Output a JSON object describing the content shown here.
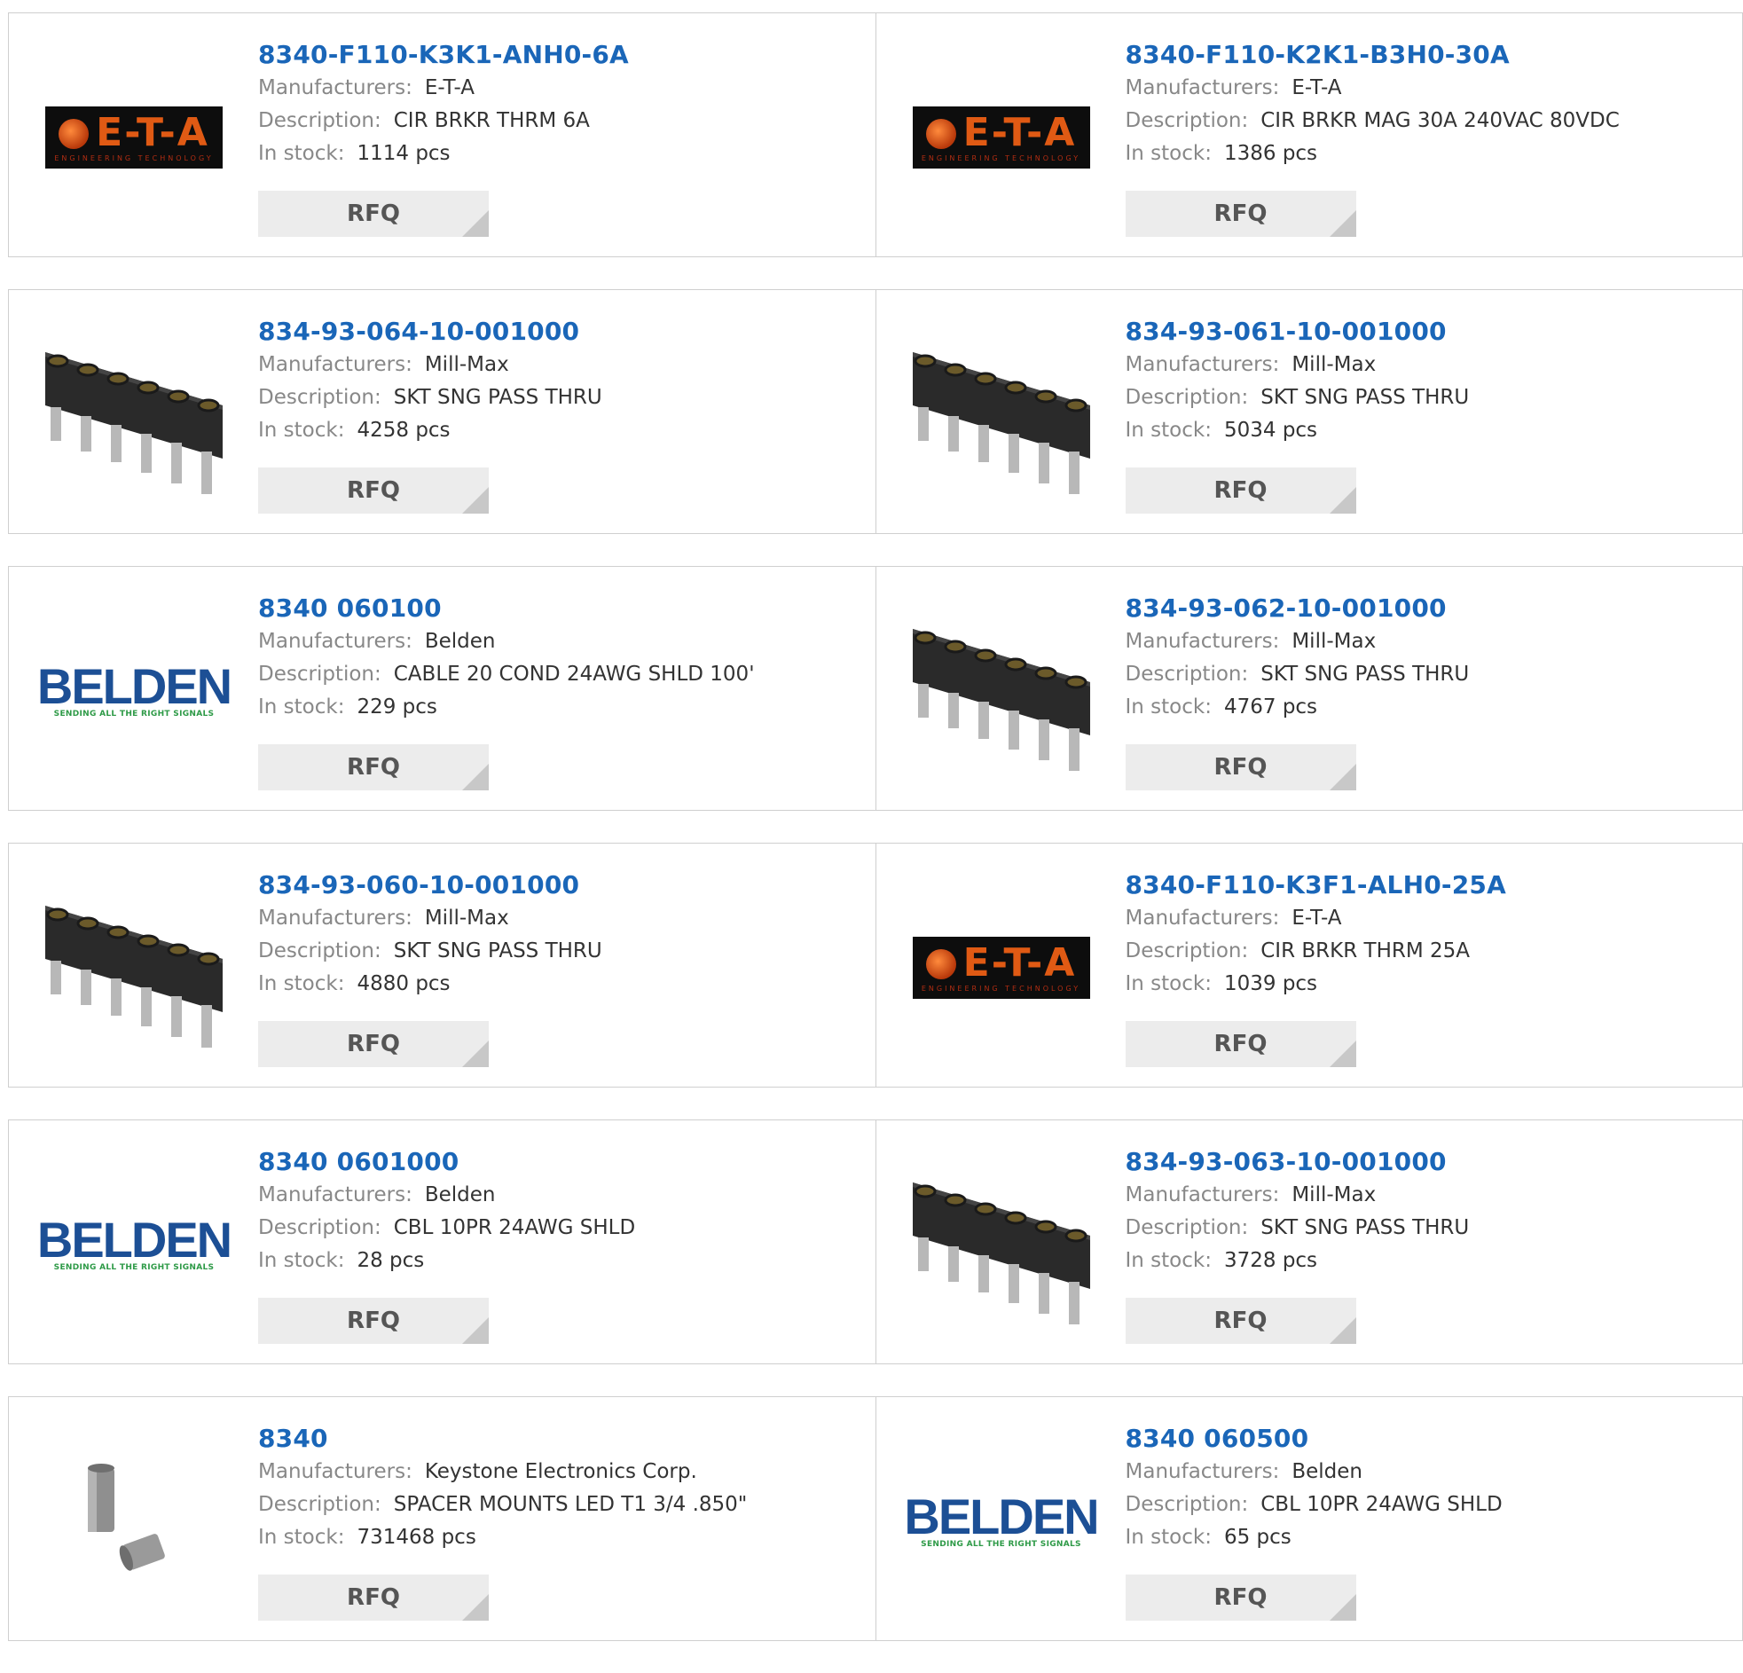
{
  "labels": {
    "manufacturers": "Manufacturers:",
    "description": "Description:",
    "in_stock": "In stock:",
    "rfq": "RFQ"
  },
  "logos": {
    "eta": {
      "main": "E-T-A",
      "sub": "ENGINEERING TECHNOLOGY"
    },
    "belden": {
      "main": "BELDEN",
      "sub": "SENDING ALL THE RIGHT SIGNALS"
    }
  },
  "colors": {
    "part_link": "#1a66b8",
    "label_gray": "#888888",
    "value_dark": "#333333",
    "rfq_bg": "#ececec",
    "border": "#cfcfcf"
  },
  "products": [
    {
      "part": "8340-F110-K3K1-ANH0-6A",
      "manufacturer": "E-T-A",
      "description": "CIR BRKR THRM 6A",
      "stock": "1114 pcs",
      "image": "eta-logo"
    },
    {
      "part": "8340-F110-K2K1-B3H0-30A",
      "manufacturer": "E-T-A",
      "description": "CIR BRKR MAG 30A 240VAC 80VDC",
      "stock": "1386 pcs",
      "image": "eta-logo"
    },
    {
      "part": "834-93-064-10-001000",
      "manufacturer": "Mill-Max",
      "description": "SKT SNG PASS THRU",
      "stock": "4258 pcs",
      "image": "socket-strip"
    },
    {
      "part": "834-93-061-10-001000",
      "manufacturer": "Mill-Max",
      "description": "SKT SNG PASS THRU",
      "stock": "5034 pcs",
      "image": "socket-strip"
    },
    {
      "part": "8340 060100",
      "manufacturer": "Belden",
      "description": "CABLE 20 COND 24AWG SHLD 100'",
      "stock": "229 pcs",
      "image": "belden-logo"
    },
    {
      "part": "834-93-062-10-001000",
      "manufacturer": "Mill-Max",
      "description": "SKT SNG PASS THRU",
      "stock": "4767 pcs",
      "image": "socket-strip"
    },
    {
      "part": "834-93-060-10-001000",
      "manufacturer": "Mill-Max",
      "description": "SKT SNG PASS THRU",
      "stock": "4880 pcs",
      "image": "socket-strip"
    },
    {
      "part": "8340-F110-K3F1-ALH0-25A",
      "manufacturer": "E-T-A",
      "description": "CIR BRKR THRM 25A",
      "stock": "1039 pcs",
      "image": "eta-logo"
    },
    {
      "part": "8340 0601000",
      "manufacturer": "Belden",
      "description": "CBL 10PR 24AWG SHLD",
      "stock": "28 pcs",
      "image": "belden-logo"
    },
    {
      "part": "834-93-063-10-001000",
      "manufacturer": "Mill-Max",
      "description": "SKT SNG PASS THRU",
      "stock": "3728 pcs",
      "image": "socket-strip"
    },
    {
      "part": "8340",
      "manufacturer": "Keystone Electronics Corp.",
      "description": "SPACER MOUNTS LED T1 3/4 .850\"",
      "stock": "731468 pcs",
      "image": "spacer-mount"
    },
    {
      "part": "8340 060500",
      "manufacturer": "Belden",
      "description": "CBL 10PR 24AWG SHLD",
      "stock": "65 pcs",
      "image": "belden-logo"
    }
  ]
}
